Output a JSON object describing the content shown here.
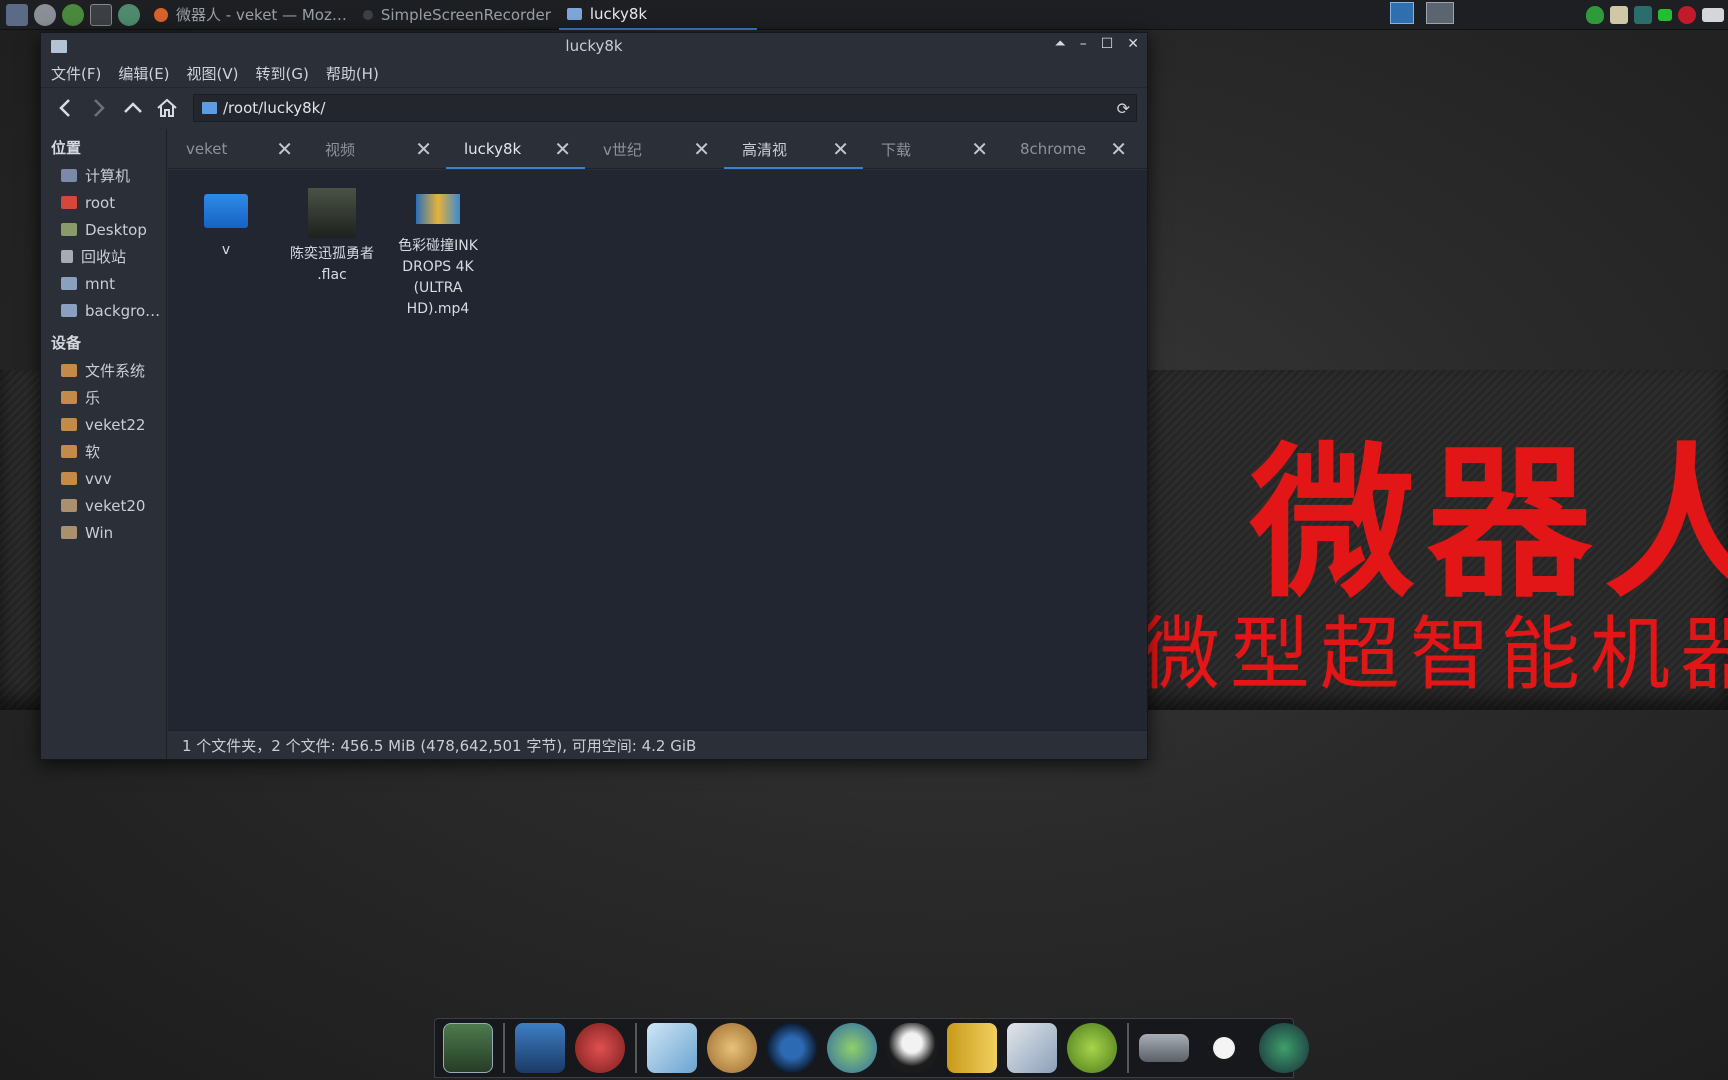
{
  "taskbar": {
    "tasks": [
      {
        "label": "微器人 - veket — Moz…"
      },
      {
        "label": "SimpleScreenRecorder"
      },
      {
        "label": "lucky8k"
      }
    ]
  },
  "wallpaper": {
    "big_text": "微器人",
    "small_text": "微型超智能机器"
  },
  "window": {
    "title": "lucky8k",
    "menu": [
      "文件(F)",
      "编辑(E)",
      "视图(V)",
      "转到(G)",
      "帮助(H)"
    ],
    "path": "/root/lucky8k/",
    "sidebar": {
      "places_heading": "位置",
      "places": [
        "计算机",
        "root",
        "Desktop",
        "回收站",
        "mnt",
        "backgro…"
      ],
      "devices_heading": "设备",
      "devices": [
        "文件系统",
        "乐",
        "veket22",
        "软",
        "vvv",
        "veket20",
        "Win"
      ]
    },
    "tabs": [
      "veket",
      "视频",
      "lucky8k",
      "v世纪",
      "高清视",
      "下载",
      "8chrome"
    ],
    "files": [
      {
        "name": "v"
      },
      {
        "name": "陈奕迅孤勇者 .flac"
      },
      {
        "name": "色彩碰撞INK DROPS 4K (ULTRA HD).mp4"
      }
    ],
    "status": "1 个文件夹，2 个文件: 456.5 MiB (478,642,501 字节), 可用空间: 4.2 GiB"
  },
  "colors": {
    "accent": "#3b7fd0",
    "banner_text": "#e21616"
  }
}
